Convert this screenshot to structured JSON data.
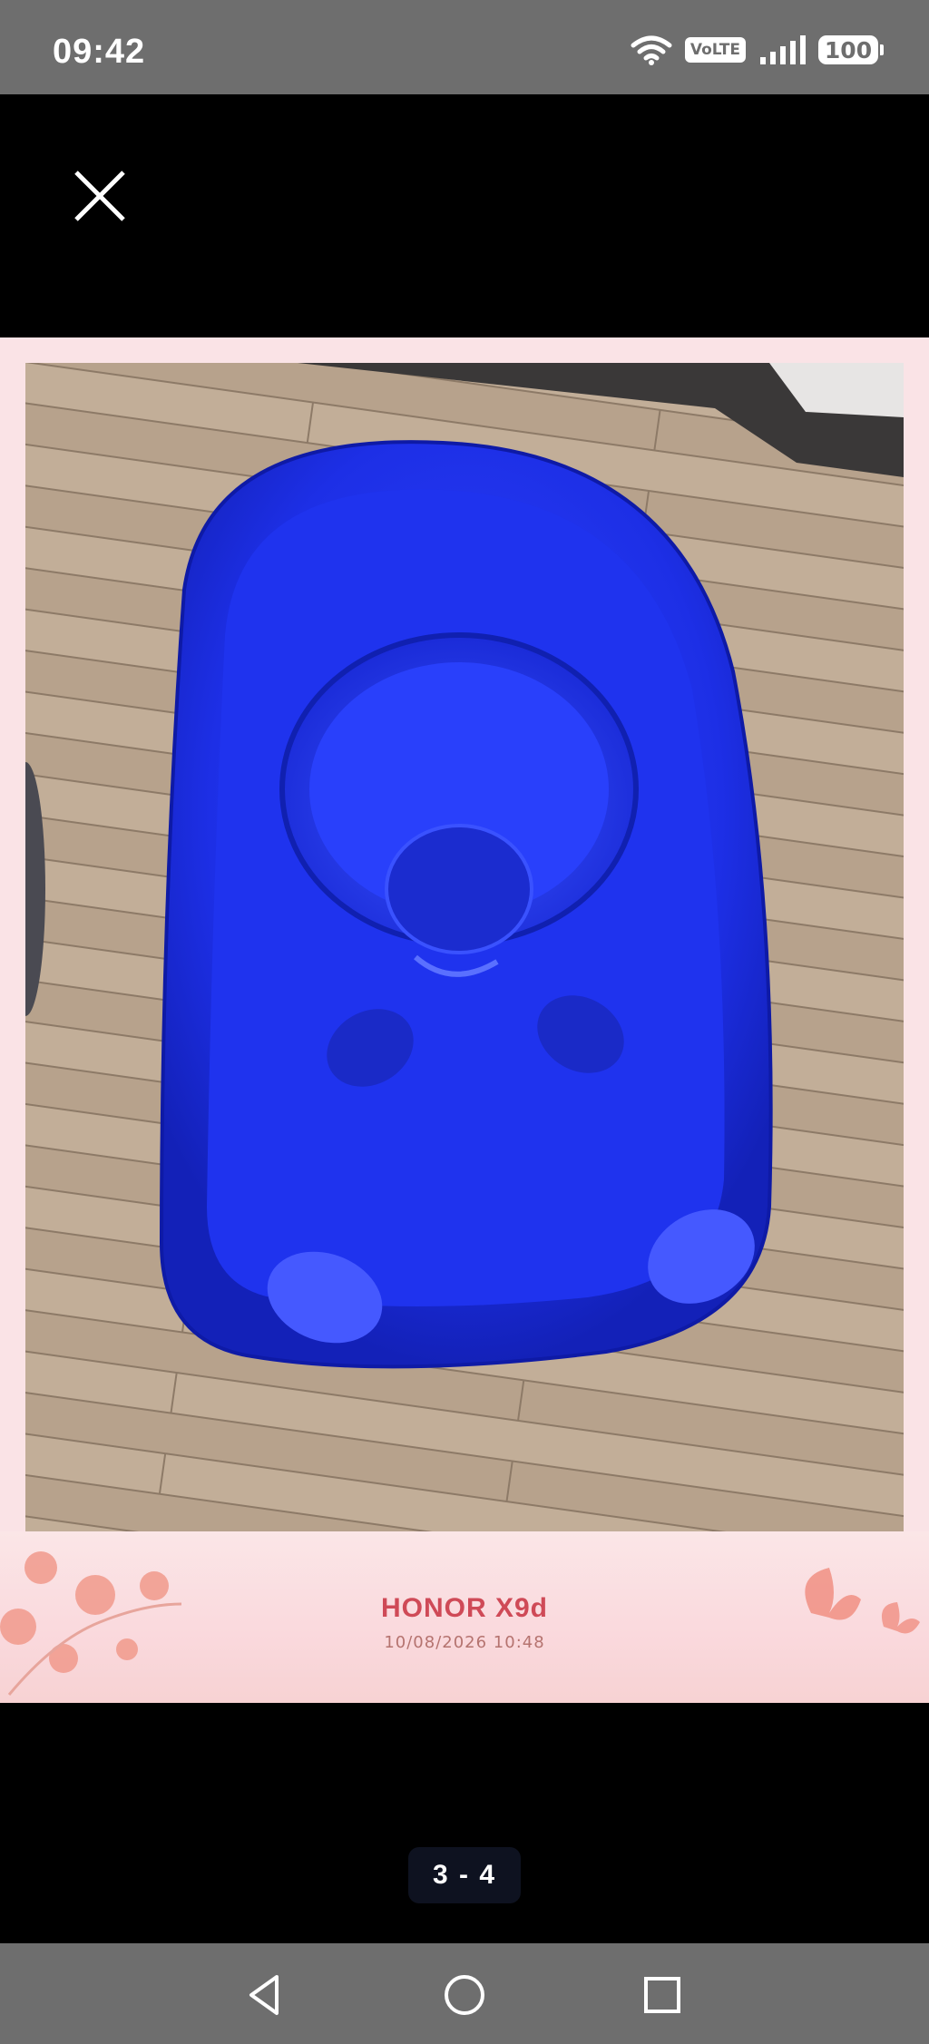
{
  "status_bar": {
    "time": "09:42",
    "network_label": "VoLTE",
    "battery_level": "100",
    "icons": [
      "wifi-icon",
      "volte-icon",
      "signal-icon",
      "battery-icon"
    ]
  },
  "viewer": {
    "close_icon": "close-icon",
    "photo_subject": "blue baby bathtub with bucket on wooden floor",
    "watermark": {
      "model": "HONOR X9d",
      "datetime": "10/08/2026 10:48"
    },
    "page_indicator": "3 - 4"
  },
  "nav_bar": {
    "icons": [
      "back-icon",
      "home-icon",
      "recents-icon"
    ]
  },
  "colors": {
    "status_bar_bg": "#6e6e6e",
    "frame_bg": "#fae3e6",
    "watermark_text": "#cf4a57",
    "tub_blue": "#1d2fe6"
  }
}
